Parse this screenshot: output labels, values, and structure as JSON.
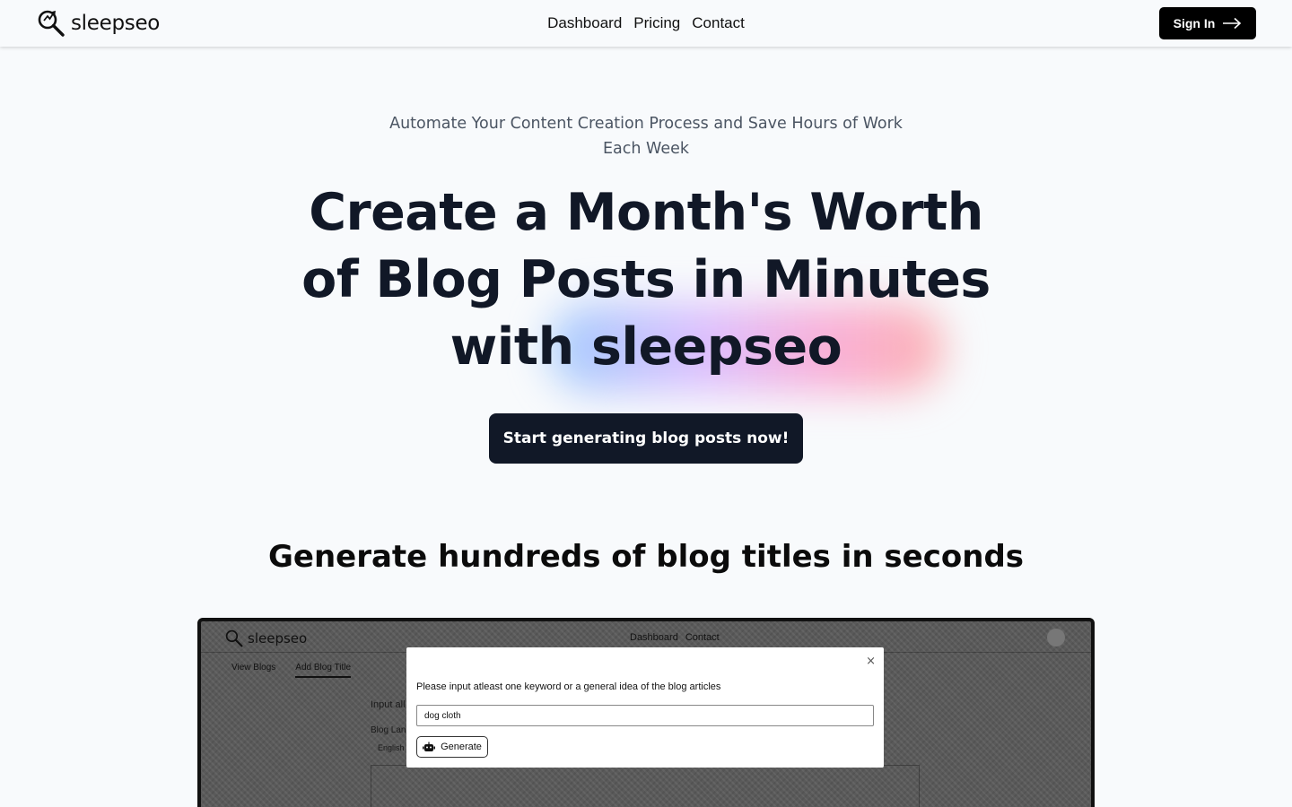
{
  "nav": {
    "brand": "sleepseo",
    "links": [
      "Dashboard",
      "Pricing",
      "Contact"
    ],
    "signin_label": "Sign In"
  },
  "hero": {
    "subtitle": "Automate Your Content Creation Process and Save Hours of Work Each Week",
    "headline": "Create a Month's Worth of Blog Posts in Minutes with sleepseo",
    "cta_label": "Start generating blog posts now!"
  },
  "section": {
    "title": "Generate hundreds of blog titles in seconds"
  },
  "demo": {
    "brand": "sleepseo",
    "links": [
      "Dashboard",
      "Contact"
    ],
    "tabs": [
      "View Blogs",
      "Add Blog Title"
    ],
    "faded_input_label": "Input all",
    "faded_language_label": "Blog Lan",
    "faded_language_value": "English",
    "modal": {
      "close": "×",
      "prompt": "Please input atleast one keyword or a general idea of the blog articles",
      "input_value": "dog cloth",
      "generate_label": "Generate"
    }
  },
  "colors": {
    "background": "#f8fafc",
    "primary_dark": "#111827",
    "signin_bg": "#000000",
    "glow_start": "#93c5fd",
    "glow_end": "#fca5a5"
  },
  "icons": {
    "brand": "magnifier-logo-icon",
    "signin": "arrow-right-icon",
    "generate": "robot-icon"
  }
}
